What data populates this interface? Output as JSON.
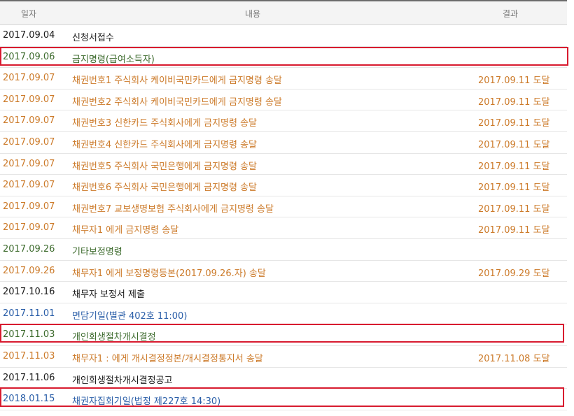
{
  "header": {
    "date": "일자",
    "content": "내용",
    "result": "결과"
  },
  "rows": [
    {
      "date": "2017.09.04",
      "content": "신청서접수",
      "result": "",
      "color": "black"
    },
    {
      "date": "2017.09.06",
      "content": "금지명령(급여소득자)",
      "result": "",
      "color": "green"
    },
    {
      "date": "2017.09.07",
      "content": "채권번호1 주식회사 케이비국민카드에게 금지명령 송달",
      "result": "2017.09.11 도달",
      "color": "orange"
    },
    {
      "date": "2017.09.07",
      "content": "채권번호2 주식회사 케이비국민카드에게 금지명령 송달",
      "result": "2017.09.11 도달",
      "color": "orange"
    },
    {
      "date": "2017.09.07",
      "content": "채권번호3 신한카드 주식회사에게 금지명령 송달",
      "result": "2017.09.11 도달",
      "color": "orange"
    },
    {
      "date": "2017.09.07",
      "content": "채권번호4 신한카드 주식회사에게 금지명령 송달",
      "result": "2017.09.11 도달",
      "color": "orange"
    },
    {
      "date": "2017.09.07",
      "content": "채권번호5 주식회사 국민은행에게 금지명령 송달",
      "result": "2017.09.11 도달",
      "color": "orange"
    },
    {
      "date": "2017.09.07",
      "content": "채권번호6 주식회사 국민은행에게 금지명령 송달",
      "result": "2017.09.11 도달",
      "color": "orange"
    },
    {
      "date": "2017.09.07",
      "content": "채권번호7 교보생명보험 주식회사에게 금지명령 송달",
      "result": "2017.09.11 도달",
      "color": "orange"
    },
    {
      "date": "2017.09.07",
      "content": "채무자1          에게 금지명령 송달",
      "result": "2017.09.11 도달",
      "color": "orange"
    },
    {
      "date": "2017.09.26",
      "content": "기타보정명령",
      "result": "",
      "color": "green"
    },
    {
      "date": "2017.09.26",
      "content": "채무자1          에게 보정명령등본(2017.09.26.자) 송달",
      "result": "2017.09.29 도달",
      "color": "orange"
    },
    {
      "date": "2017.10.16",
      "content": "채무자              보정서 제출",
      "result": "",
      "color": "black"
    },
    {
      "date": "2017.11.01",
      "content": "면담기일(별관 402호 11:00)",
      "result": "",
      "color": "blue"
    },
    {
      "date": "2017.11.03",
      "content": "개인회생절차개시결정",
      "result": "",
      "color": "green"
    },
    {
      "date": "2017.11.03",
      "content": "채무자1 :          에게 개시결정정본/개시결정통지서 송달",
      "result": "2017.11.08 도달",
      "color": "orange"
    },
    {
      "date": "2017.11.06",
      "content": "개인회생절차개시결정공고",
      "result": "",
      "color": "black"
    },
    {
      "date": "2018.01.15",
      "content": "채권자집회기일(법정 제227호 14:30)",
      "result": "",
      "color": "blue"
    }
  ],
  "colors": {
    "black": "#1a1a1a",
    "orange": "#cc7a29",
    "green": "#3d6b2d",
    "blue": "#2a5ea8",
    "highlight": "#d81b2f"
  }
}
